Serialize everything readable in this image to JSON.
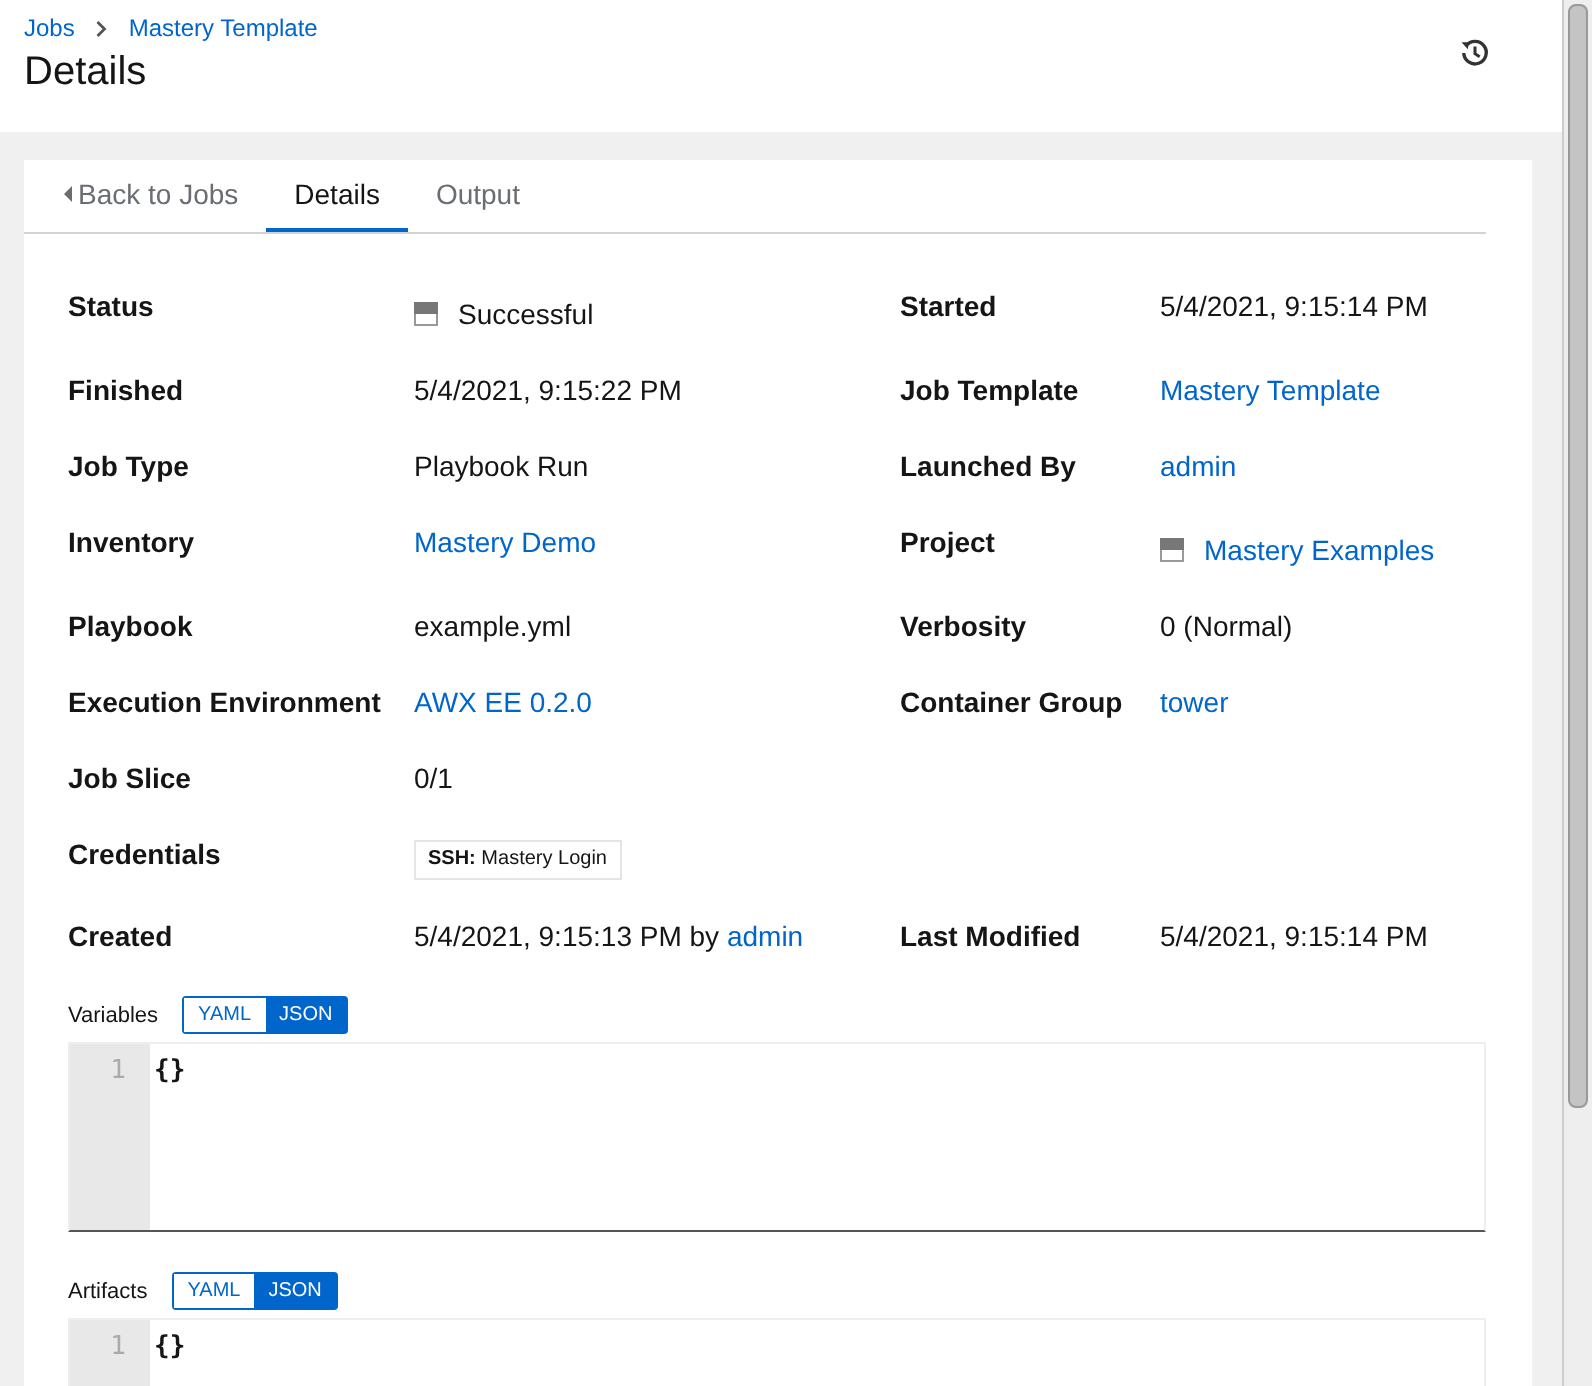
{
  "breadcrumbs": [
    {
      "label": "Jobs"
    },
    {
      "label": "Mastery Template"
    }
  ],
  "title": "Details",
  "tabs": [
    {
      "label": "Back to Jobs",
      "kind": "back",
      "selected": false
    },
    {
      "label": "Details",
      "kind": "tab",
      "selected": true
    },
    {
      "label": "Output",
      "kind": "tab",
      "selected": false
    }
  ],
  "rows": [
    {
      "left": {
        "label": "Status",
        "kind": "status",
        "value": "Successful"
      },
      "right": {
        "label": "Started",
        "kind": "text",
        "value": "5/4/2021, 9:15:14 PM"
      }
    },
    {
      "left": {
        "label": "Finished",
        "kind": "text",
        "value": "5/4/2021, 9:15:22 PM"
      },
      "right": {
        "label": "Job Template",
        "kind": "link",
        "value": "Mastery Template"
      }
    },
    {
      "left": {
        "label": "Job Type",
        "kind": "text",
        "value": "Playbook Run"
      },
      "right": {
        "label": "Launched By",
        "kind": "link",
        "value": "admin"
      }
    },
    {
      "left": {
        "label": "Inventory",
        "kind": "link",
        "value": "Mastery Demo"
      },
      "right": {
        "label": "Project",
        "kind": "icon_link",
        "value": "Mastery Examples"
      }
    },
    {
      "left": {
        "label": "Playbook",
        "kind": "text",
        "value": "example.yml"
      },
      "right": {
        "label": "Verbosity",
        "kind": "text",
        "value": "0 (Normal)"
      }
    },
    {
      "left": {
        "label": "Execution Environment",
        "kind": "link",
        "value": "AWX EE 0.2.0"
      },
      "right": {
        "label": "Container Group",
        "kind": "link",
        "value": "tower"
      }
    },
    {
      "left": {
        "label": "Job Slice",
        "kind": "text",
        "value": "0/1"
      }
    },
    {
      "left": {
        "label": "Credentials",
        "kind": "chip",
        "prefix": "SSH:",
        "value": "Mastery Login"
      }
    },
    {
      "left": {
        "label": "Created",
        "kind": "created",
        "value": "5/4/2021, 9:15:13 PM by",
        "link": "admin"
      },
      "right": {
        "label": "Last Modified",
        "kind": "text",
        "value": "5/4/2021, 9:15:14 PM"
      }
    }
  ],
  "editors": [
    {
      "label": "Variables",
      "modes": [
        {
          "label": "YAML",
          "selected": false
        },
        {
          "label": "JSON",
          "selected": true
        }
      ],
      "lines": [
        {
          "number": "1",
          "text": "{}"
        }
      ]
    },
    {
      "label": "Artifacts",
      "modes": [
        {
          "label": "YAML",
          "selected": false
        },
        {
          "label": "JSON",
          "selected": true
        }
      ],
      "lines": [
        {
          "number": "1",
          "text": "{}"
        }
      ]
    }
  ]
}
